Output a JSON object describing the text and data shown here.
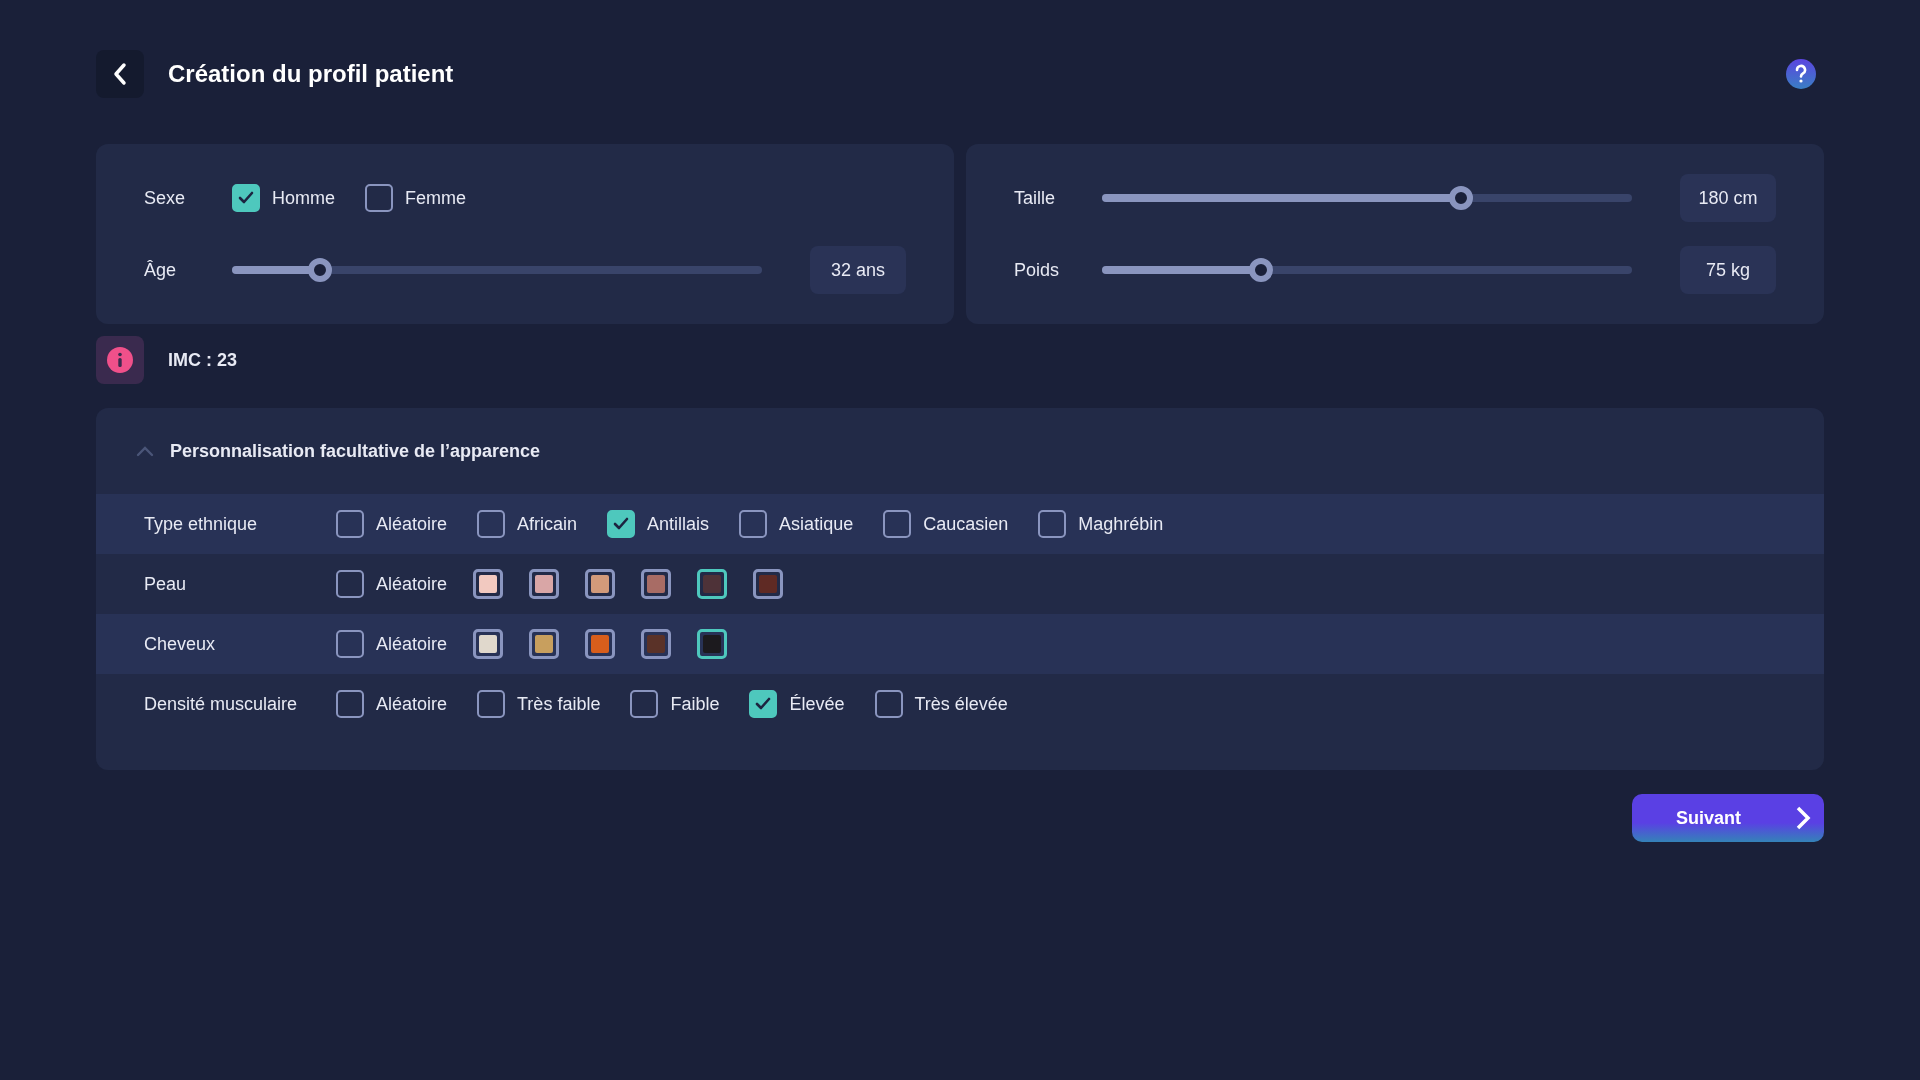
{
  "header": {
    "title": "Création du profil patient"
  },
  "sex": {
    "label": "Sexe",
    "options": [
      {
        "label": "Homme",
        "checked": true
      },
      {
        "label": "Femme",
        "checked": false
      }
    ]
  },
  "left_sliders": [
    {
      "label": "Âge",
      "level": 0.166,
      "reading": "32 ans"
    }
  ],
  "right_sliders": [
    {
      "label": "Taille",
      "level": 0.677,
      "reading": "180 cm"
    },
    {
      "label": "Poids",
      "level": 0.3,
      "reading": "75 kg"
    }
  ],
  "bmi": {
    "text": "IMC : 23"
  },
  "appearance": {
    "title": "Personnalisation facultative de l’apparence",
    "expanded": true,
    "rows": [
      {
        "label": "Type ethnique",
        "items": [
          {
            "kind": "checkbox",
            "label": "Aléatoire",
            "checked": false
          },
          {
            "kind": "checkbox",
            "label": "Africain",
            "checked": false
          },
          {
            "kind": "checkbox",
            "label": "Antillais",
            "checked": true
          },
          {
            "kind": "checkbox",
            "label": "Asiatique",
            "checked": false
          },
          {
            "kind": "checkbox",
            "label": "Caucasien",
            "checked": false
          },
          {
            "kind": "checkbox",
            "label": "Maghrébin",
            "checked": false
          }
        ]
      },
      {
        "label": "Peau",
        "items": [
          {
            "kind": "checkbox",
            "label": "Aléatoire",
            "checked": false
          },
          {
            "kind": "swatch",
            "color": "#f2c9c0",
            "selected": false
          },
          {
            "kind": "swatch",
            "color": "#d9a6a6",
            "selected": false
          },
          {
            "kind": "swatch",
            "color": "#d29a7a",
            "selected": false
          },
          {
            "kind": "swatch",
            "color": "#a86c65",
            "selected": false
          },
          {
            "kind": "swatch",
            "color": "#4e3238",
            "selected": true
          },
          {
            "kind": "swatch",
            "color": "#5f2a24",
            "selected": false
          }
        ]
      },
      {
        "label": "Cheveux",
        "items": [
          {
            "kind": "checkbox",
            "label": "Aléatoire",
            "checked": false
          },
          {
            "kind": "swatch",
            "color": "#e0d8cc",
            "selected": false
          },
          {
            "kind": "swatch",
            "color": "#c89f5e",
            "selected": false
          },
          {
            "kind": "swatch",
            "color": "#d85e1c",
            "selected": false
          },
          {
            "kind": "swatch",
            "color": "#5a3228",
            "selected": false
          },
          {
            "kind": "swatch",
            "color": "#1c1a1e",
            "selected": true
          }
        ]
      },
      {
        "label": "Densité musculaire",
        "items": [
          {
            "kind": "checkbox",
            "label": "Aléatoire",
            "checked": false
          },
          {
            "kind": "checkbox",
            "label": "Très faible",
            "checked": false
          },
          {
            "kind": "checkbox",
            "label": "Faible",
            "checked": false
          },
          {
            "kind": "checkbox",
            "label": "Élevée",
            "checked": true
          },
          {
            "kind": "checkbox",
            "label": "Très élevée",
            "checked": false
          }
        ]
      }
    ]
  },
  "next_button": {
    "label": "Suivant"
  }
}
